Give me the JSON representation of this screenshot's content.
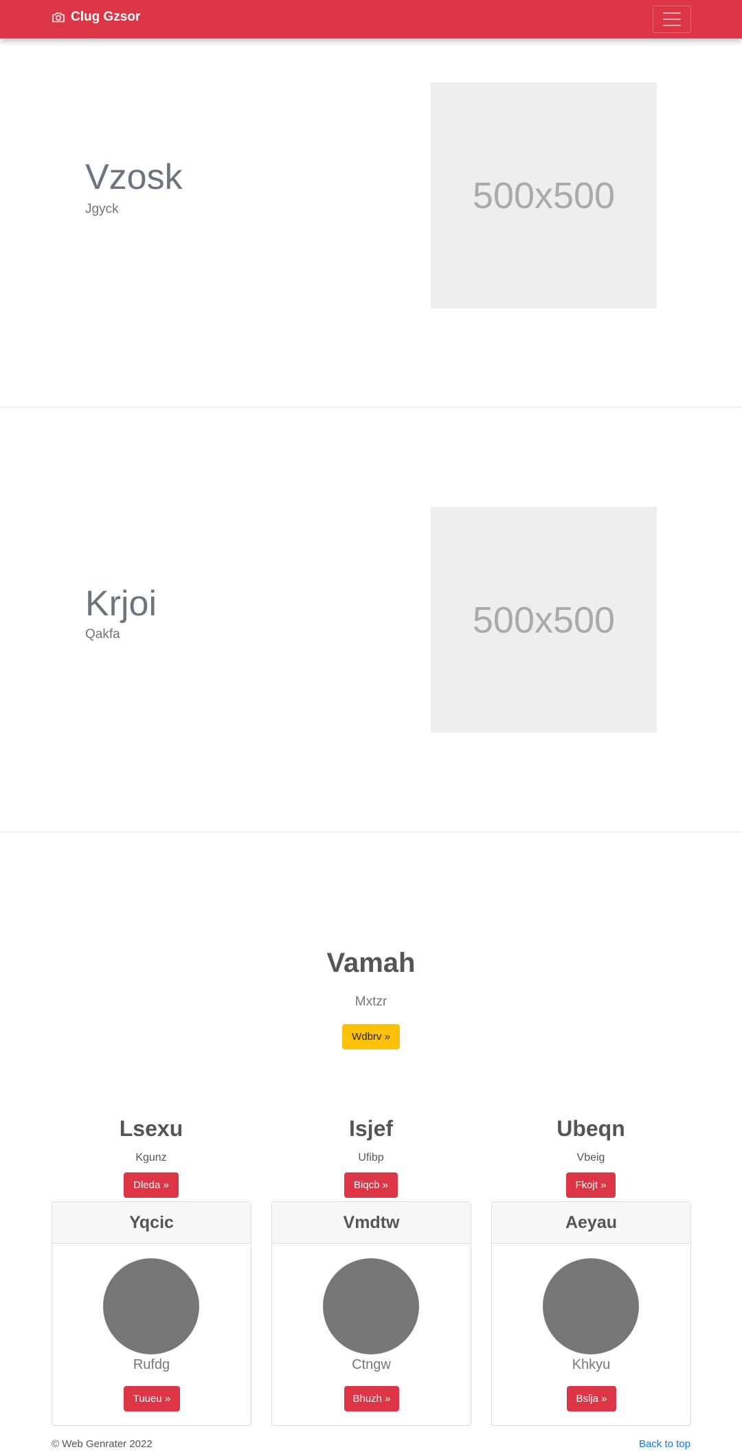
{
  "navbar": {
    "brand": "Clug Gzsor",
    "brand_icon": "camera-icon",
    "toggler_icon": "hamburger-menu-icon",
    "color": "#dc3545"
  },
  "features": [
    {
      "heading": "Vzosk",
      "subheading": "Jgyck",
      "image_label": "500x500"
    },
    {
      "heading": "Krjoi",
      "subheading": "Qakfa",
      "image_label": "500x500"
    }
  ],
  "hero": {
    "title": "Vamah",
    "subtitle": "Mxtzr",
    "button": "Wdbrv »",
    "button_color": "#ffc107"
  },
  "columns": [
    {
      "title": "Lsexu",
      "subtitle": "Kgunz",
      "button": "Dleda »"
    },
    {
      "title": "Isjef",
      "subtitle": "Ufibp",
      "button": "Biqcb »"
    },
    {
      "title": "Ubeqn",
      "subtitle": "Vbeig",
      "button": "Fkojt »"
    }
  ],
  "cards": [
    {
      "title": "Yqcic",
      "subtitle": "Rufdg",
      "button": "Tuueu »"
    },
    {
      "title": "Vmdtw",
      "subtitle": "Ctngw",
      "button": "Bhuzh »"
    },
    {
      "title": "Aeyau",
      "subtitle": "Khkyu",
      "button": "Bslja »"
    }
  ],
  "footer": {
    "copyright": "© Web Genrater 2022",
    "back_to_top": "Back to top",
    "link_color": "#007bff"
  }
}
